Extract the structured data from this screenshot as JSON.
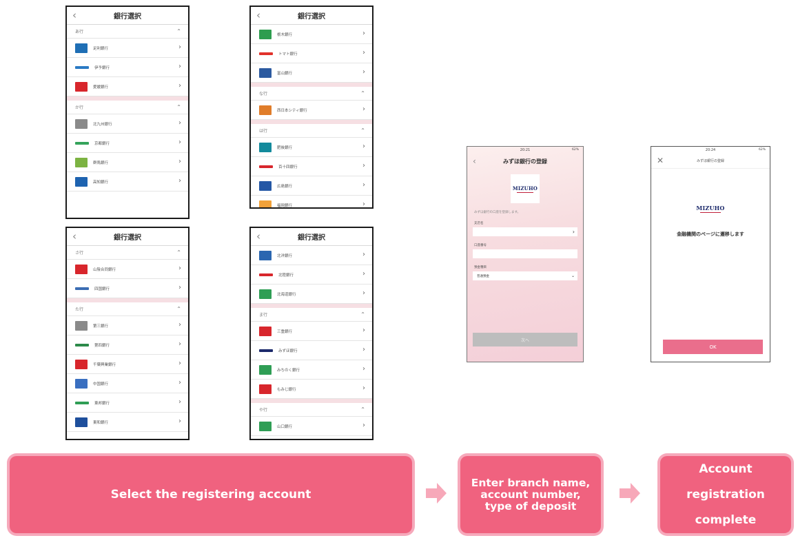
{
  "bank_select": {
    "title": "銀行選択",
    "screens": [
      {
        "sections": [
          {
            "label": "あ行",
            "banks": [
              {
                "name": "足利銀行",
                "color": "#1f6fb5"
              },
              {
                "name": "伊予銀行",
                "color": "#2a7ac4"
              },
              {
                "name": "愛媛銀行",
                "color": "#d8262c"
              }
            ]
          },
          {
            "label": "か行",
            "banks": [
              {
                "name": "北九州銀行",
                "color": "#8a8a8a"
              },
              {
                "name": "京都銀行",
                "color": "#35a35b"
              },
              {
                "name": "群馬銀行",
                "color": "#7cb342"
              },
              {
                "name": "高知銀行",
                "color": "#1e63b0"
              }
            ]
          }
        ]
      },
      {
        "sections": [
          {
            "label": "",
            "banks": [
              {
                "name": "栃木銀行",
                "color": "#2e9d4f"
              },
              {
                "name": "トマト銀行",
                "color": "#e1322b"
              },
              {
                "name": "富山銀行",
                "color": "#2c5aa0"
              }
            ]
          },
          {
            "label": "な行",
            "banks": [
              {
                "name": "西日本シティ銀行",
                "color": "#e07d2a"
              }
            ]
          },
          {
            "label": "は行",
            "banks": [
              {
                "name": "肥後銀行",
                "color": "#138a9c"
              },
              {
                "name": "百十四銀行",
                "color": "#d8262c"
              },
              {
                "name": "広島銀行",
                "color": "#2457a5"
              },
              {
                "name": "福岡銀行",
                "color": "#f2a23a"
              }
            ]
          }
        ]
      },
      {
        "sections": [
          {
            "label": "さ行",
            "banks": [
              {
                "name": "山陰合同銀行",
                "color": "#d8262c"
              },
              {
                "name": "四国銀行",
                "color": "#3b6db3"
              }
            ]
          },
          {
            "label": "た行",
            "banks": [
              {
                "name": "第三銀行",
                "color": "#8a8a8a"
              },
              {
                "name": "第四銀行",
                "color": "#2d8a4a"
              },
              {
                "name": "千葉興業銀行",
                "color": "#d8262c"
              },
              {
                "name": "中国銀行",
                "color": "#3a6fc0"
              },
              {
                "name": "東邦銀行",
                "color": "#2f9e55"
              },
              {
                "name": "東和銀行",
                "color": "#1e4f9c"
              }
            ]
          }
        ]
      },
      {
        "sections": [
          {
            "label": "",
            "banks": [
              {
                "name": "北洋銀行",
                "color": "#2a66b0"
              },
              {
                "name": "北陸銀行",
                "color": "#d8262c"
              },
              {
                "name": "北海道銀行",
                "color": "#2f9e55"
              }
            ]
          },
          {
            "label": "ま行",
            "banks": [
              {
                "name": "三重銀行",
                "color": "#d8262c"
              },
              {
                "name": "みずほ銀行",
                "color": "#1c2a6b"
              },
              {
                "name": "みちのく銀行",
                "color": "#2f9e55"
              },
              {
                "name": "もみじ銀行",
                "color": "#d8262c"
              }
            ]
          },
          {
            "label": "や行",
            "banks": [
              {
                "name": "山口銀行",
                "color": "#2f9e55"
              }
            ]
          }
        ]
      }
    ]
  },
  "registration": {
    "status_time": "20:21",
    "battery": "62%",
    "title": "みずほ銀行の登録",
    "logo_text": "MIZUHO",
    "description": "みずほ銀行の口座を登録します。",
    "branch_label": "支店名",
    "account_label": "口座番号",
    "deposit_label": "預金種目",
    "deposit_value": "普通預金",
    "next_label": "次へ"
  },
  "transition": {
    "status_time": "20:24",
    "battery": "62%",
    "title": "みずほ銀行の登録",
    "logo_text": "MIZUHO",
    "message": "金融機関のページに遷移します",
    "ok_label": "OK"
  },
  "steps": {
    "step1": "Select the registering account",
    "step2": "Enter branch name, account number, type of deposit",
    "step3": "Account registration complete"
  },
  "colors": {
    "accent": "#f0627f",
    "accent_light": "#f6a9bb",
    "ok_button": "#ea6e8c"
  }
}
